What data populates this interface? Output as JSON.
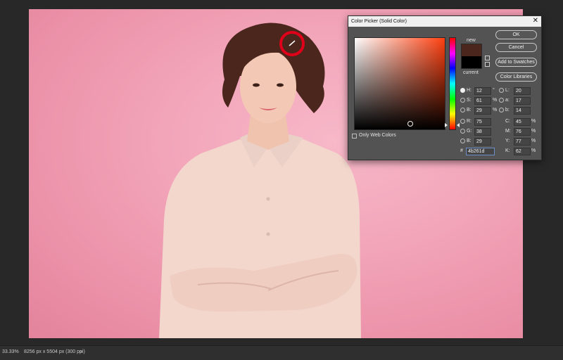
{
  "status": {
    "zoom": "33.33%",
    "doc_size": "8256 px x 5504 px (300 ppi)",
    "arrow": "›"
  },
  "dialog": {
    "title": "Color Picker (Solid Color)",
    "close": "✕",
    "new_label": "new",
    "current_label": "current",
    "new_color": "#4b261d",
    "current_color": "#000000",
    "buttons": {
      "ok": "OK",
      "cancel": "Cancel",
      "add_swatches": "Add to Swatches",
      "libraries": "Color Libraries"
    },
    "only_web_colors": "Only Web Colors",
    "fields": {
      "H": {
        "label": "H:",
        "value": "12",
        "unit": "°"
      },
      "S": {
        "label": "S:",
        "value": "61",
        "unit": "%"
      },
      "Bv": {
        "label": "B:",
        "value": "29",
        "unit": "%"
      },
      "R": {
        "label": "R:",
        "value": "75"
      },
      "G": {
        "label": "G:",
        "value": "38"
      },
      "Bb": {
        "label": "B:",
        "value": "29"
      },
      "L": {
        "label": "L:",
        "value": "20"
      },
      "a": {
        "label": "a:",
        "value": "17"
      },
      "b": {
        "label": "b:",
        "value": "14"
      },
      "C": {
        "label": "C:",
        "value": "45",
        "unit": "%"
      },
      "M": {
        "label": "M:",
        "value": "76",
        "unit": "%"
      },
      "Y": {
        "label": "Y:",
        "value": "77",
        "unit": "%"
      },
      "K": {
        "label": "K:",
        "value": "62",
        "unit": "%"
      }
    },
    "hash": "#",
    "hex_value": "4b261d",
    "selected_mode": "H"
  },
  "colors": {
    "background": "#f3a7bb",
    "shirt": "#f3d6cc",
    "hair": "#4b261d",
    "highlight_circle": "#e0001a"
  }
}
